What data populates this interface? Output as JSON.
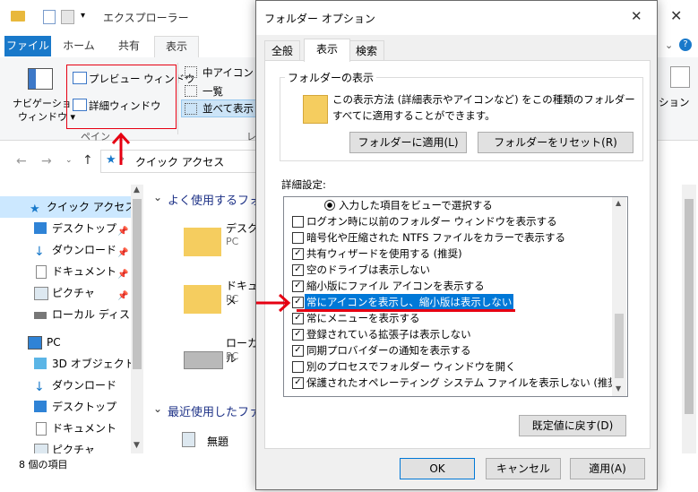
{
  "explorer": {
    "title": "エクスプローラー",
    "ribbon_tabs": [
      "ファイル",
      "ホーム",
      "共有",
      "表示"
    ],
    "ribbon": {
      "nav_pane": "ナビゲーション",
      "nav_pane2": "ウィンドウ",
      "preview": "プレビュー ウィンドウ",
      "details": "詳細ウィンドウ",
      "pane_group": "ペイン",
      "medium_icons": "中アイコン",
      "list": "一覧",
      "tiles": "並べて表示",
      "layout_group_cut": "レ",
      "options_cut": "ション"
    },
    "address": "クイック アクセス",
    "nav": {
      "quick": "クイック アクセス",
      "desktop": "デスクトップ",
      "downloads": "ダウンロード",
      "documents": "ドキュメント",
      "pictures": "ピクチャ",
      "local_disk": "ローカル ディスク (C",
      "pc": "PC",
      "objects3d": "3D オブジェクト",
      "pc_downloads": "ダウンロード",
      "pc_desktop": "デスクトップ",
      "pc_documents": "ドキュメント",
      "pc_pictures": "ピクチャ"
    },
    "content": {
      "frequent": "よく使用するフォル",
      "item1": "デスク",
      "item1_sub": "PC",
      "item2": "ドキュメ",
      "item2_sub": "PC",
      "item3": "ローカル",
      "item3_sub": "PC",
      "recent": "最近使用したファ",
      "recent1": "無題"
    },
    "status": "8 個の項目"
  },
  "dialog": {
    "title": "フォルダー オプション",
    "tabs": [
      "全般",
      "表示",
      "検索"
    ],
    "folder_view_title": "フォルダーの表示",
    "folder_view_desc": "この表示方法 (詳細表示やアイコンなど) をこの種類のフォルダーすべてに適用することができます。",
    "apply_folders": "フォルダーに適用(L)",
    "reset_folders": "フォルダーをリセット(R)",
    "advanced_label": "詳細設定:",
    "advanced": [
      {
        "type": "radio",
        "checked": true,
        "label": "入力した項目をビューで選択する"
      },
      {
        "type": "check",
        "checked": false,
        "label": "ログオン時に以前のフォルダー ウィンドウを表示する"
      },
      {
        "type": "check",
        "checked": false,
        "label": "暗号化や圧縮された NTFS ファイルをカラーで表示する"
      },
      {
        "type": "check",
        "checked": true,
        "label": "共有ウィザードを使用する (推奨)"
      },
      {
        "type": "check",
        "checked": true,
        "label": "空のドライブは表示しない"
      },
      {
        "type": "check",
        "checked": true,
        "label": "縮小版にファイル アイコンを表示する"
      },
      {
        "type": "check",
        "checked": true,
        "label": "常にアイコンを表示し、縮小版は表示しない",
        "highlight": true
      },
      {
        "type": "check",
        "checked": true,
        "label": "常にメニューを表示する"
      },
      {
        "type": "check",
        "checked": true,
        "label": "登録されている拡張子は表示しない"
      },
      {
        "type": "check",
        "checked": true,
        "label": "同期プロバイダーの通知を表示する"
      },
      {
        "type": "check",
        "checked": false,
        "label": "別のプロセスでフォルダー ウィンドウを開く"
      },
      {
        "type": "check",
        "checked": true,
        "label": "保護されたオペレーティング システム ファイルを表示しない (推奨)"
      }
    ],
    "restore_defaults": "既定値に戻す(D)",
    "ok": "OK",
    "cancel": "キャンセル",
    "apply": "適用(A)"
  },
  "colors": {
    "accent": "#0078d7",
    "file_tab": "#1979ca",
    "annotation_red": "#e60012"
  }
}
